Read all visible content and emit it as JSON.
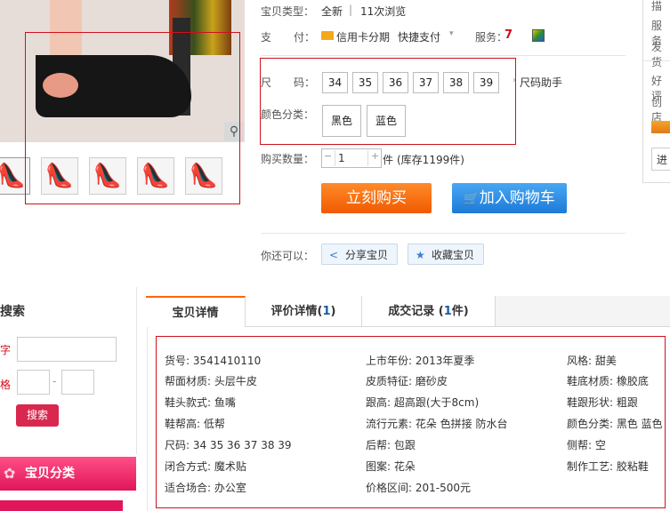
{
  "product": {
    "type_label": "宝贝类型：",
    "type_value": "全新",
    "type_sep": "|",
    "views": "11次浏览",
    "pay_label_1": "支",
    "pay_label_2": "付：",
    "pay_option_1": "信用卡分期",
    "pay_option_2": "快捷支付",
    "service_label": "服务："
  },
  "size": {
    "label_1": "尺",
    "label_2": "码：",
    "options": [
      "34",
      "35",
      "36",
      "37",
      "38",
      "39"
    ],
    "helper": "尺码助手"
  },
  "color": {
    "label": "颜色分类：",
    "options": [
      "黑色",
      "蓝色"
    ]
  },
  "quantity": {
    "label": "购买数量：",
    "value": "1",
    "unit": "件",
    "stock": "(库存1199件)"
  },
  "actions": {
    "buy_now": "立刻购买",
    "add_cart": "加入购物车",
    "also_label": "你还可以：",
    "share": "分享宝贝",
    "favorite": "收藏宝贝"
  },
  "shop_panel": {
    "lines": [
      "描",
      "服务",
      "发货",
      "好评",
      "创店",
      "进"
    ]
  },
  "sidebar": {
    "search_title": "搜索",
    "keyword_label": "字",
    "price_label": "格",
    "price_sep": "-",
    "search_button": "搜索",
    "category_title": "宝贝分类"
  },
  "tabs": [
    {
      "label": "宝贝详情",
      "count": ""
    },
    {
      "label": "评价详情(",
      "count": "1",
      "close": ")"
    },
    {
      "label": "成交记录 (",
      "count": "1",
      "close": "件)"
    }
  ],
  "attributes": [
    [
      "货号: 3541410110",
      "上市年份: 2013年夏季",
      "风格: 甜美"
    ],
    [
      "帮面材质: 头层牛皮",
      "皮质特征: 磨砂皮",
      "鞋底材质: 橡胶底"
    ],
    [
      "鞋头款式: 鱼嘴",
      "跟高: 超高跟(大于8cm)",
      "鞋跟形状: 粗跟"
    ],
    [
      "鞋帮高: 低帮",
      "流行元素: 花朵 色拼接 防水台",
      "颜色分类: 黑色 蓝色"
    ],
    [
      "尺码: 34 35 36 37 38 39",
      "后帮: 包跟",
      "侧帮: 空"
    ],
    [
      "闭合方式: 魔术贴",
      "图案: 花朵",
      "制作工艺: 胶粘鞋"
    ],
    [
      "适合场合: 办公室",
      "价格区间: 201-500元",
      ""
    ]
  ],
  "colors": {
    "accent_orange": "#ff6600",
    "cart_blue": "#1d7ad8",
    "highlight_red": "#d0101c",
    "sidebar_pink": "#e0165a"
  }
}
